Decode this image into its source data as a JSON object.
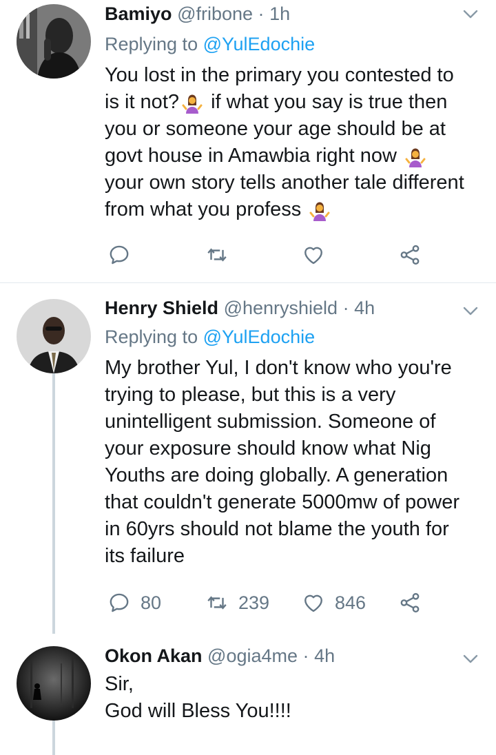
{
  "tweets": [
    {
      "name": "Bamiyo",
      "handle": "@fribone",
      "time": "1h",
      "replying_prefix": "Replying to",
      "replying_to": "@YulEdochie",
      "lines": [
        "You lost in the primary you contested to",
        "is it not?",
        "if what you say is true then",
        "you or someone your age should be at",
        "govt house in Amawbia right now",
        "your own story tells another tale different",
        "from what you profess"
      ],
      "counts": {
        "replies": "",
        "retweets": "",
        "likes": ""
      }
    },
    {
      "name": "Henry Shield",
      "handle": "@henryshield",
      "time": "4h",
      "replying_prefix": "Replying to",
      "replying_to": "@YulEdochie",
      "lines": [
        "My brother Yul, I don't know who you're",
        "trying to please, but this is a very",
        "unintelligent submission. Someone of",
        "your exposure should know what Nig",
        "Youths are doing globally. A generation",
        "that couldn't generate 5000mw of power",
        "in 60yrs should not blame the youth for",
        "its failure"
      ],
      "counts": {
        "replies": "80",
        "retweets": "239",
        "likes": "846"
      }
    },
    {
      "name": "Okon Akan",
      "handle": "@ogia4me",
      "time": "4h",
      "lines": [
        "Sir,",
        "God will Bless You!!!!"
      ]
    }
  ],
  "separator": "·",
  "icons": {
    "reply": "reply-icon",
    "retweet": "retweet-icon",
    "like": "heart-icon",
    "share": "share-icon",
    "menu": "chevron-down-icon",
    "emoji": "person-shrugging-emoji"
  },
  "colors": {
    "text": "#14171a",
    "secondary": "#657786",
    "link": "#1da1f2",
    "divider": "#e1e8ed",
    "thread_line": "#ccd6dd"
  }
}
